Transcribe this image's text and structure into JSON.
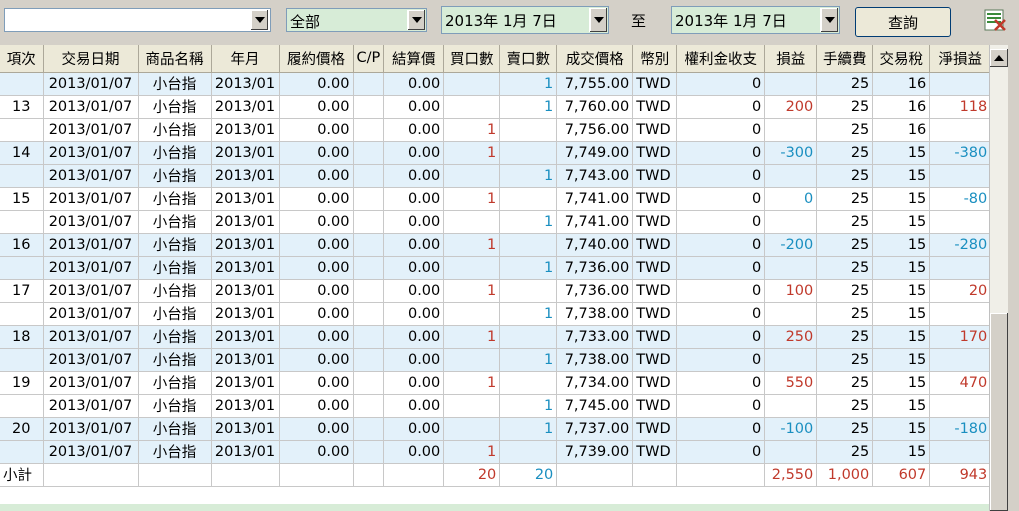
{
  "toolbar": {
    "account_value": "",
    "product_filter": "全部",
    "date_from": "2013年  1月  7日",
    "to_label": "至",
    "date_to": "2013年  1月  7日",
    "query_button": "查詢",
    "export_icon": "excel-export-icon"
  },
  "table": {
    "columns": [
      "項次",
      "交易日期",
      "商品名稱",
      "年月",
      "履約價格",
      "C/P",
      "結算價",
      "買口數",
      "賣口數",
      "成交價格",
      "幣別",
      "權利金收支",
      "損益",
      "手續費",
      "交易稅",
      "淨損益"
    ],
    "rows": [
      {
        "item": "",
        "date": "2013/01/07",
        "product": "小台指",
        "ym": "2013/01",
        "strike": "0.00",
        "cp": "",
        "settle": "0.00",
        "buy": "",
        "sell": "1",
        "price": "7,755.00",
        "cur": "TWD",
        "premium": "0",
        "pl": "",
        "fee": "25",
        "tax": "16",
        "net": "",
        "pl_color": "",
        "net_color": "",
        "band": "blue"
      },
      {
        "item": "13",
        "date": "2013/01/07",
        "product": "小台指",
        "ym": "2013/01",
        "strike": "0.00",
        "cp": "",
        "settle": "0.00",
        "buy": "",
        "sell": "1",
        "price": "7,760.00",
        "cur": "TWD",
        "premium": "0",
        "pl": "200",
        "fee": "25",
        "tax": "16",
        "net": "118",
        "pl_color": "red",
        "net_color": "red",
        "band": "white"
      },
      {
        "item": "",
        "date": "2013/01/07",
        "product": "小台指",
        "ym": "2013/01",
        "strike": "0.00",
        "cp": "",
        "settle": "0.00",
        "buy": "1",
        "sell": "",
        "price": "7,756.00",
        "cur": "TWD",
        "premium": "0",
        "pl": "",
        "fee": "25",
        "tax": "16",
        "net": "",
        "pl_color": "",
        "net_color": "",
        "band": "white"
      },
      {
        "item": "14",
        "date": "2013/01/07",
        "product": "小台指",
        "ym": "2013/01",
        "strike": "0.00",
        "cp": "",
        "settle": "0.00",
        "buy": "1",
        "sell": "",
        "price": "7,749.00",
        "cur": "TWD",
        "premium": "0",
        "pl": "-300",
        "fee": "25",
        "tax": "15",
        "net": "-380",
        "pl_color": "cyan",
        "net_color": "cyan",
        "band": "blue"
      },
      {
        "item": "",
        "date": "2013/01/07",
        "product": "小台指",
        "ym": "2013/01",
        "strike": "0.00",
        "cp": "",
        "settle": "0.00",
        "buy": "",
        "sell": "1",
        "price": "7,743.00",
        "cur": "TWD",
        "premium": "0",
        "pl": "",
        "fee": "25",
        "tax": "15",
        "net": "",
        "pl_color": "",
        "net_color": "",
        "band": "blue"
      },
      {
        "item": "15",
        "date": "2013/01/07",
        "product": "小台指",
        "ym": "2013/01",
        "strike": "0.00",
        "cp": "",
        "settle": "0.00",
        "buy": "1",
        "sell": "",
        "price": "7,741.00",
        "cur": "TWD",
        "premium": "0",
        "pl": "0",
        "fee": "25",
        "tax": "15",
        "net": "-80",
        "pl_color": "cyan",
        "net_color": "cyan",
        "band": "white"
      },
      {
        "item": "",
        "date": "2013/01/07",
        "product": "小台指",
        "ym": "2013/01",
        "strike": "0.00",
        "cp": "",
        "settle": "0.00",
        "buy": "",
        "sell": "1",
        "price": "7,741.00",
        "cur": "TWD",
        "premium": "0",
        "pl": "",
        "fee": "25",
        "tax": "15",
        "net": "",
        "pl_color": "",
        "net_color": "",
        "band": "white"
      },
      {
        "item": "16",
        "date": "2013/01/07",
        "product": "小台指",
        "ym": "2013/01",
        "strike": "0.00",
        "cp": "",
        "settle": "0.00",
        "buy": "1",
        "sell": "",
        "price": "7,740.00",
        "cur": "TWD",
        "premium": "0",
        "pl": "-200",
        "fee": "25",
        "tax": "15",
        "net": "-280",
        "pl_color": "cyan",
        "net_color": "cyan",
        "band": "blue"
      },
      {
        "item": "",
        "date": "2013/01/07",
        "product": "小台指",
        "ym": "2013/01",
        "strike": "0.00",
        "cp": "",
        "settle": "0.00",
        "buy": "",
        "sell": "1",
        "price": "7,736.00",
        "cur": "TWD",
        "premium": "0",
        "pl": "",
        "fee": "25",
        "tax": "15",
        "net": "",
        "pl_color": "",
        "net_color": "",
        "band": "blue"
      },
      {
        "item": "17",
        "date": "2013/01/07",
        "product": "小台指",
        "ym": "2013/01",
        "strike": "0.00",
        "cp": "",
        "settle": "0.00",
        "buy": "1",
        "sell": "",
        "price": "7,736.00",
        "cur": "TWD",
        "premium": "0",
        "pl": "100",
        "fee": "25",
        "tax": "15",
        "net": "20",
        "pl_color": "red",
        "net_color": "red",
        "band": "white"
      },
      {
        "item": "",
        "date": "2013/01/07",
        "product": "小台指",
        "ym": "2013/01",
        "strike": "0.00",
        "cp": "",
        "settle": "0.00",
        "buy": "",
        "sell": "1",
        "price": "7,738.00",
        "cur": "TWD",
        "premium": "0",
        "pl": "",
        "fee": "25",
        "tax": "15",
        "net": "",
        "pl_color": "",
        "net_color": "",
        "band": "white"
      },
      {
        "item": "18",
        "date": "2013/01/07",
        "product": "小台指",
        "ym": "2013/01",
        "strike": "0.00",
        "cp": "",
        "settle": "0.00",
        "buy": "1",
        "sell": "",
        "price": "7,733.00",
        "cur": "TWD",
        "premium": "0",
        "pl": "250",
        "fee": "25",
        "tax": "15",
        "net": "170",
        "pl_color": "red",
        "net_color": "red",
        "band": "blue"
      },
      {
        "item": "",
        "date": "2013/01/07",
        "product": "小台指",
        "ym": "2013/01",
        "strike": "0.00",
        "cp": "",
        "settle": "0.00",
        "buy": "",
        "sell": "1",
        "price": "7,738.00",
        "cur": "TWD",
        "premium": "0",
        "pl": "",
        "fee": "25",
        "tax": "15",
        "net": "",
        "pl_color": "",
        "net_color": "",
        "band": "blue"
      },
      {
        "item": "19",
        "date": "2013/01/07",
        "product": "小台指",
        "ym": "2013/01",
        "strike": "0.00",
        "cp": "",
        "settle": "0.00",
        "buy": "1",
        "sell": "",
        "price": "7,734.00",
        "cur": "TWD",
        "premium": "0",
        "pl": "550",
        "fee": "25",
        "tax": "15",
        "net": "470",
        "pl_color": "red",
        "net_color": "red",
        "band": "white"
      },
      {
        "item": "",
        "date": "2013/01/07",
        "product": "小台指",
        "ym": "2013/01",
        "strike": "0.00",
        "cp": "",
        "settle": "0.00",
        "buy": "",
        "sell": "1",
        "price": "7,745.00",
        "cur": "TWD",
        "premium": "0",
        "pl": "",
        "fee": "25",
        "tax": "15",
        "net": "",
        "pl_color": "",
        "net_color": "",
        "band": "white"
      },
      {
        "item": "20",
        "date": "2013/01/07",
        "product": "小台指",
        "ym": "2013/01",
        "strike": "0.00",
        "cp": "",
        "settle": "0.00",
        "buy": "",
        "sell": "1",
        "price": "7,737.00",
        "cur": "TWD",
        "premium": "0",
        "pl": "-100",
        "fee": "25",
        "tax": "15",
        "net": "-180",
        "pl_color": "cyan",
        "net_color": "cyan",
        "band": "blue"
      },
      {
        "item": "",
        "date": "2013/01/07",
        "product": "小台指",
        "ym": "2013/01",
        "strike": "0.00",
        "cp": "",
        "settle": "0.00",
        "buy": "1",
        "sell": "",
        "price": "7,739.00",
        "cur": "TWD",
        "premium": "0",
        "pl": "",
        "fee": "25",
        "tax": "15",
        "net": "",
        "pl_color": "",
        "net_color": "",
        "band": "blue"
      }
    ],
    "subtotal": {
      "label": "小計",
      "buy": "20",
      "sell": "20",
      "pl": "2,550",
      "fee": "1,000",
      "tax": "607",
      "net": "943"
    }
  },
  "colors": {
    "profit": "#c0392b",
    "loss": "#1a8fc0",
    "band_blue": "#e3f1fa",
    "header": "#ece9d8"
  }
}
